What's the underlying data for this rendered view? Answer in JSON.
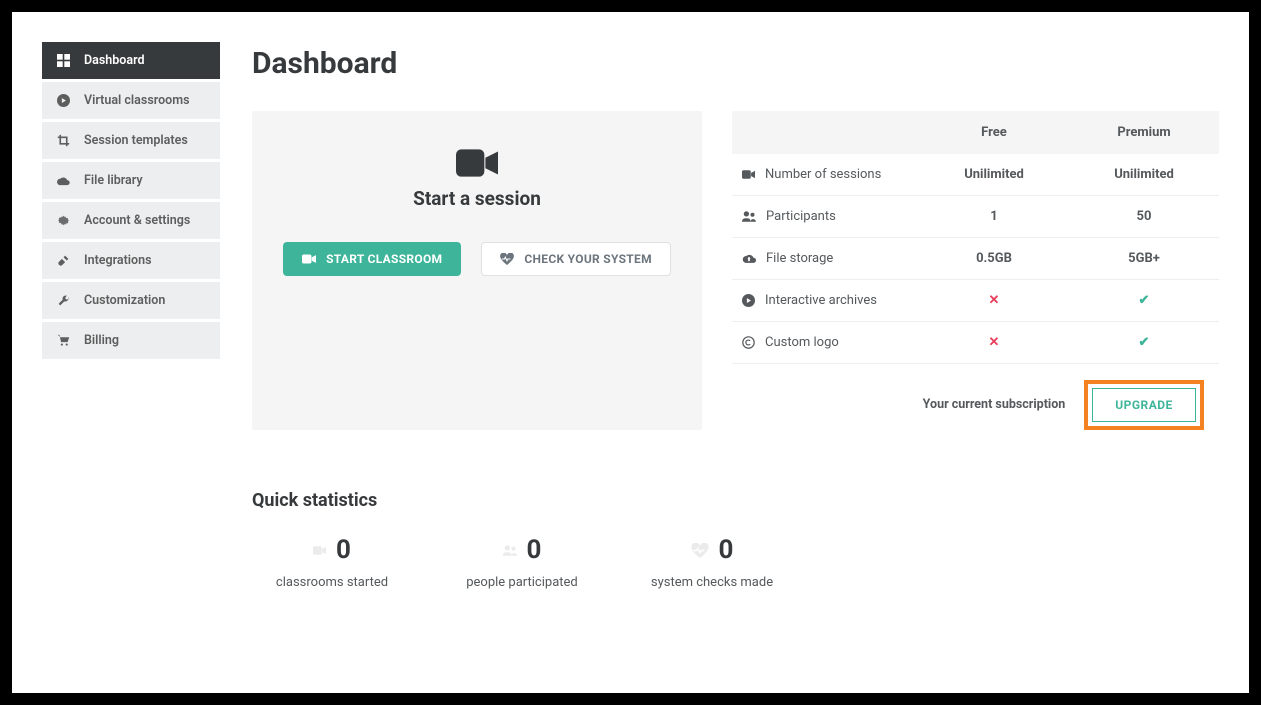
{
  "sidebar": {
    "items": [
      {
        "label": "Dashboard",
        "icon": "grid-icon",
        "active": true
      },
      {
        "label": "Virtual classrooms",
        "icon": "play-circle-icon"
      },
      {
        "label": "Session templates",
        "icon": "crop-icon"
      },
      {
        "label": "File library",
        "icon": "cloud-icon"
      },
      {
        "label": "Account & settings",
        "icon": "gear-icon"
      },
      {
        "label": "Integrations",
        "icon": "plug-icon"
      },
      {
        "label": "Customization",
        "icon": "wrench-icon"
      },
      {
        "label": "Billing",
        "icon": "cart-icon"
      }
    ]
  },
  "page_title": "Dashboard",
  "start_session": {
    "title": "Start a session",
    "primary_btn": "START CLASSROOM",
    "secondary_btn": "CHECK YOUR SYSTEM"
  },
  "plan_table": {
    "headers": {
      "free": "Free",
      "premium": "Premium"
    },
    "rows": [
      {
        "icon": "camera-icon",
        "label": "Number of sessions",
        "free": "Unilimited",
        "premium": "Unilimited"
      },
      {
        "icon": "users-icon",
        "label": "Participants",
        "free": "1",
        "premium": "50"
      },
      {
        "icon": "cloud-up-icon",
        "label": "File storage",
        "free": "0.5GB",
        "premium": "5GB+"
      },
      {
        "icon": "play-circle-icon",
        "label": "Interactive archives",
        "free": false,
        "premium": true
      },
      {
        "icon": "copyright-icon",
        "label": "Custom logo",
        "free": false,
        "premium": true
      }
    ],
    "subscription_label": "Your current subscription",
    "upgrade_btn": "UPGRADE"
  },
  "stats": {
    "title": "Quick statistics",
    "items": [
      {
        "icon": "camera-icon",
        "value": "0",
        "label": "classrooms started"
      },
      {
        "icon": "users-icon",
        "value": "0",
        "label": "people participated"
      },
      {
        "icon": "heartbeat-icon",
        "value": "0",
        "label": "system checks made"
      }
    ]
  }
}
